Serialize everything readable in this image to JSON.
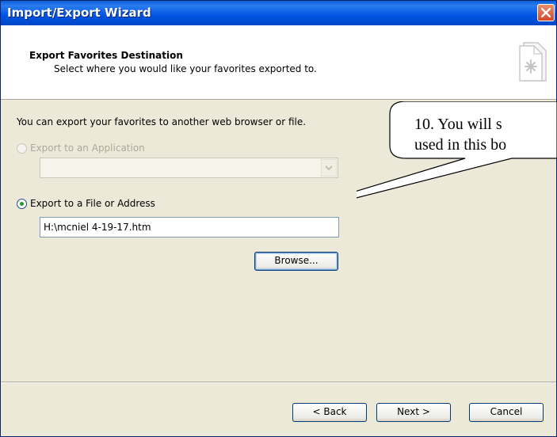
{
  "window": {
    "title": "Import/Export Wizard"
  },
  "header": {
    "title": "Export Favorites Destination",
    "subtitle": "Select where you would like your favorites exported to."
  },
  "content": {
    "intro": "You can export your favorites to another web browser or file.",
    "option_app": "Export to an Application",
    "option_file": "Export to a File or Address",
    "file_path": "H:\\mcniel 4-19-17.htm",
    "browse_label": "Browse..."
  },
  "footer": {
    "back_label": "< Back",
    "next_label": "Next >",
    "cancel_label": "Cancel"
  },
  "callout": {
    "line1": "10. You will s",
    "line2": "used in this bo"
  },
  "icons": {
    "close": "close-icon",
    "header": "favorites-file-icon",
    "dropdown": "chevron-down-icon"
  },
  "colors": {
    "titlebar": "#0054e3",
    "dialog_bg": "#ece9d8",
    "close_button": "#d3482c",
    "radio_selected": "#21a121"
  }
}
